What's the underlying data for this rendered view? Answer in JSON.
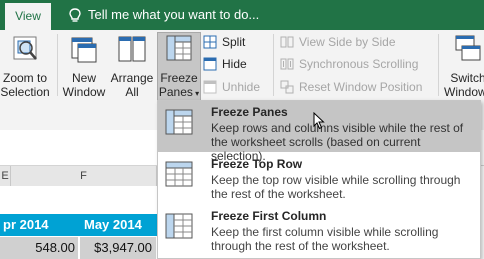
{
  "titlebar": {
    "tab_view": "View",
    "tellme": "Tell me what you want to do..."
  },
  "ribbon": {
    "zoom_to_selection": [
      "Zoom to",
      "Selection"
    ],
    "new_window": [
      "New",
      "Window"
    ],
    "arrange_all": [
      "Arrange",
      "All"
    ],
    "freeze_panes": [
      "Freeze",
      "Panes"
    ],
    "split": "Split",
    "hide": "Hide",
    "unhide": "Unhide",
    "view_side_by_side": "View Side by Side",
    "synchronous_scrolling": "Synchronous Scrolling",
    "reset_window_position": "Reset Window Position",
    "switch_windows": [
      "Switch",
      "Windows"
    ]
  },
  "sheet": {
    "columns": [
      "E",
      "F"
    ],
    "header_cells": [
      "pr 2014",
      "May 2014"
    ],
    "value_cells": [
      "548.00",
      "$3,947.00"
    ]
  },
  "menu": {
    "items": [
      {
        "title": "Freeze Panes",
        "desc": "Keep rows and columns visible while the rest of the worksheet scrolls (based on current selection).",
        "highlighted": true
      },
      {
        "title": "Freeze Top Row",
        "desc": "Keep the top row visible while scrolling through the rest of the worksheet.",
        "highlighted": false
      },
      {
        "title": "Freeze First Column",
        "desc": "Keep the first column visible while scrolling through the rest of the worksheet.",
        "highlighted": false
      }
    ]
  },
  "colors": {
    "brand": "#217346",
    "header_blue": "#00a2d4",
    "menu_highlight": "#c5c5c5"
  }
}
